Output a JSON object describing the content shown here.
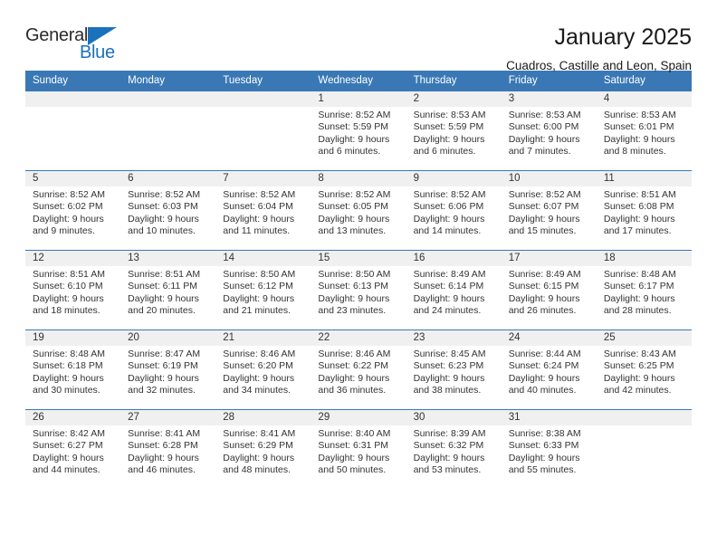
{
  "brand": {
    "name_top": "General",
    "name_bottom": "Blue",
    "triangle_color": "#1a72bb"
  },
  "header": {
    "title": "January 2025",
    "subtitle": "Cuadros, Castille and Leon, Spain"
  },
  "theme": {
    "header_blue": "#3a78b5",
    "day_band_gray": "#f0f0f0",
    "text_color": "#333333"
  },
  "weekdays": [
    "Sunday",
    "Monday",
    "Tuesday",
    "Wednesday",
    "Thursday",
    "Friday",
    "Saturday"
  ],
  "labels": {
    "sunrise_prefix": "Sunrise:",
    "sunset_prefix": "Sunset:",
    "daylight_prefix": "Daylight:"
  },
  "weeks": [
    [
      {
        "day": "",
        "sunrise": "",
        "sunset": "",
        "daylight_line1": "",
        "daylight_line2": ""
      },
      {
        "day": "",
        "sunrise": "",
        "sunset": "",
        "daylight_line1": "",
        "daylight_line2": ""
      },
      {
        "day": "",
        "sunrise": "",
        "sunset": "",
        "daylight_line1": "",
        "daylight_line2": ""
      },
      {
        "day": "1",
        "sunrise": "Sunrise: 8:52 AM",
        "sunset": "Sunset: 5:59 PM",
        "daylight_line1": "Daylight: 9 hours",
        "daylight_line2": "and 6 minutes."
      },
      {
        "day": "2",
        "sunrise": "Sunrise: 8:53 AM",
        "sunset": "Sunset: 5:59 PM",
        "daylight_line1": "Daylight: 9 hours",
        "daylight_line2": "and 6 minutes."
      },
      {
        "day": "3",
        "sunrise": "Sunrise: 8:53 AM",
        "sunset": "Sunset: 6:00 PM",
        "daylight_line1": "Daylight: 9 hours",
        "daylight_line2": "and 7 minutes."
      },
      {
        "day": "4",
        "sunrise": "Sunrise: 8:53 AM",
        "sunset": "Sunset: 6:01 PM",
        "daylight_line1": "Daylight: 9 hours",
        "daylight_line2": "and 8 minutes."
      }
    ],
    [
      {
        "day": "5",
        "sunrise": "Sunrise: 8:52 AM",
        "sunset": "Sunset: 6:02 PM",
        "daylight_line1": "Daylight: 9 hours",
        "daylight_line2": "and 9 minutes."
      },
      {
        "day": "6",
        "sunrise": "Sunrise: 8:52 AM",
        "sunset": "Sunset: 6:03 PM",
        "daylight_line1": "Daylight: 9 hours",
        "daylight_line2": "and 10 minutes."
      },
      {
        "day": "7",
        "sunrise": "Sunrise: 8:52 AM",
        "sunset": "Sunset: 6:04 PM",
        "daylight_line1": "Daylight: 9 hours",
        "daylight_line2": "and 11 minutes."
      },
      {
        "day": "8",
        "sunrise": "Sunrise: 8:52 AM",
        "sunset": "Sunset: 6:05 PM",
        "daylight_line1": "Daylight: 9 hours",
        "daylight_line2": "and 13 minutes."
      },
      {
        "day": "9",
        "sunrise": "Sunrise: 8:52 AM",
        "sunset": "Sunset: 6:06 PM",
        "daylight_line1": "Daylight: 9 hours",
        "daylight_line2": "and 14 minutes."
      },
      {
        "day": "10",
        "sunrise": "Sunrise: 8:52 AM",
        "sunset": "Sunset: 6:07 PM",
        "daylight_line1": "Daylight: 9 hours",
        "daylight_line2": "and 15 minutes."
      },
      {
        "day": "11",
        "sunrise": "Sunrise: 8:51 AM",
        "sunset": "Sunset: 6:08 PM",
        "daylight_line1": "Daylight: 9 hours",
        "daylight_line2": "and 17 minutes."
      }
    ],
    [
      {
        "day": "12",
        "sunrise": "Sunrise: 8:51 AM",
        "sunset": "Sunset: 6:10 PM",
        "daylight_line1": "Daylight: 9 hours",
        "daylight_line2": "and 18 minutes."
      },
      {
        "day": "13",
        "sunrise": "Sunrise: 8:51 AM",
        "sunset": "Sunset: 6:11 PM",
        "daylight_line1": "Daylight: 9 hours",
        "daylight_line2": "and 20 minutes."
      },
      {
        "day": "14",
        "sunrise": "Sunrise: 8:50 AM",
        "sunset": "Sunset: 6:12 PM",
        "daylight_line1": "Daylight: 9 hours",
        "daylight_line2": "and 21 minutes."
      },
      {
        "day": "15",
        "sunrise": "Sunrise: 8:50 AM",
        "sunset": "Sunset: 6:13 PM",
        "daylight_line1": "Daylight: 9 hours",
        "daylight_line2": "and 23 minutes."
      },
      {
        "day": "16",
        "sunrise": "Sunrise: 8:49 AM",
        "sunset": "Sunset: 6:14 PM",
        "daylight_line1": "Daylight: 9 hours",
        "daylight_line2": "and 24 minutes."
      },
      {
        "day": "17",
        "sunrise": "Sunrise: 8:49 AM",
        "sunset": "Sunset: 6:15 PM",
        "daylight_line1": "Daylight: 9 hours",
        "daylight_line2": "and 26 minutes."
      },
      {
        "day": "18",
        "sunrise": "Sunrise: 8:48 AM",
        "sunset": "Sunset: 6:17 PM",
        "daylight_line1": "Daylight: 9 hours",
        "daylight_line2": "and 28 minutes."
      }
    ],
    [
      {
        "day": "19",
        "sunrise": "Sunrise: 8:48 AM",
        "sunset": "Sunset: 6:18 PM",
        "daylight_line1": "Daylight: 9 hours",
        "daylight_line2": "and 30 minutes."
      },
      {
        "day": "20",
        "sunrise": "Sunrise: 8:47 AM",
        "sunset": "Sunset: 6:19 PM",
        "daylight_line1": "Daylight: 9 hours",
        "daylight_line2": "and 32 minutes."
      },
      {
        "day": "21",
        "sunrise": "Sunrise: 8:46 AM",
        "sunset": "Sunset: 6:20 PM",
        "daylight_line1": "Daylight: 9 hours",
        "daylight_line2": "and 34 minutes."
      },
      {
        "day": "22",
        "sunrise": "Sunrise: 8:46 AM",
        "sunset": "Sunset: 6:22 PM",
        "daylight_line1": "Daylight: 9 hours",
        "daylight_line2": "and 36 minutes."
      },
      {
        "day": "23",
        "sunrise": "Sunrise: 8:45 AM",
        "sunset": "Sunset: 6:23 PM",
        "daylight_line1": "Daylight: 9 hours",
        "daylight_line2": "and 38 minutes."
      },
      {
        "day": "24",
        "sunrise": "Sunrise: 8:44 AM",
        "sunset": "Sunset: 6:24 PM",
        "daylight_line1": "Daylight: 9 hours",
        "daylight_line2": "and 40 minutes."
      },
      {
        "day": "25",
        "sunrise": "Sunrise: 8:43 AM",
        "sunset": "Sunset: 6:25 PM",
        "daylight_line1": "Daylight: 9 hours",
        "daylight_line2": "and 42 minutes."
      }
    ],
    [
      {
        "day": "26",
        "sunrise": "Sunrise: 8:42 AM",
        "sunset": "Sunset: 6:27 PM",
        "daylight_line1": "Daylight: 9 hours",
        "daylight_line2": "and 44 minutes."
      },
      {
        "day": "27",
        "sunrise": "Sunrise: 8:41 AM",
        "sunset": "Sunset: 6:28 PM",
        "daylight_line1": "Daylight: 9 hours",
        "daylight_line2": "and 46 minutes."
      },
      {
        "day": "28",
        "sunrise": "Sunrise: 8:41 AM",
        "sunset": "Sunset: 6:29 PM",
        "daylight_line1": "Daylight: 9 hours",
        "daylight_line2": "and 48 minutes."
      },
      {
        "day": "29",
        "sunrise": "Sunrise: 8:40 AM",
        "sunset": "Sunset: 6:31 PM",
        "daylight_line1": "Daylight: 9 hours",
        "daylight_line2": "and 50 minutes."
      },
      {
        "day": "30",
        "sunrise": "Sunrise: 8:39 AM",
        "sunset": "Sunset: 6:32 PM",
        "daylight_line1": "Daylight: 9 hours",
        "daylight_line2": "and 53 minutes."
      },
      {
        "day": "31",
        "sunrise": "Sunrise: 8:38 AM",
        "sunset": "Sunset: 6:33 PM",
        "daylight_line1": "Daylight: 9 hours",
        "daylight_line2": "and 55 minutes."
      },
      {
        "day": "",
        "sunrise": "",
        "sunset": "",
        "daylight_line1": "",
        "daylight_line2": ""
      }
    ]
  ]
}
